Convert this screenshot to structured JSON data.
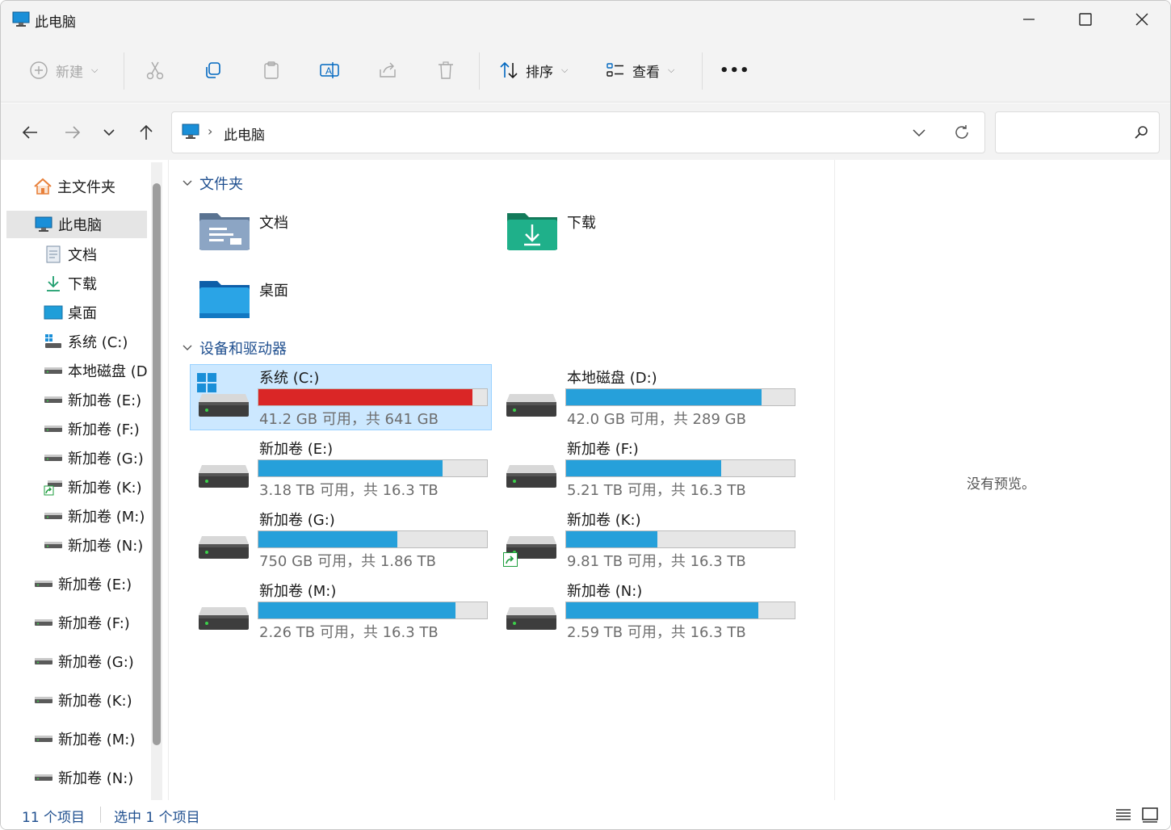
{
  "window": {
    "title": "此电脑"
  },
  "toolbar": {
    "new_label": "新建",
    "sort_label": "排序",
    "view_label": "查看",
    "more_label": "•••"
  },
  "nav": {
    "breadcrumb": "此电脑",
    "breadcrumb_separator": "›",
    "search_placeholder": ""
  },
  "sidebar": {
    "home": "主文件夹",
    "this_pc": "此电脑",
    "items": [
      {
        "label": "文档",
        "icon": "documents-icon"
      },
      {
        "label": "下载",
        "icon": "downloads-icon"
      },
      {
        "label": "桌面",
        "icon": "desktop-icon"
      },
      {
        "label": "系统 (C:)",
        "icon": "windows-drive-icon"
      },
      {
        "label": "本地磁盘 (D",
        "icon": "drive-icon"
      },
      {
        "label": "新加卷 (E:)",
        "icon": "drive-icon"
      },
      {
        "label": "新加卷 (F:)",
        "icon": "drive-icon"
      },
      {
        "label": "新加卷 (G:)",
        "icon": "drive-icon"
      },
      {
        "label": "新加卷 (K:)",
        "icon": "network-drive-icon"
      },
      {
        "label": "新加卷 (M:)",
        "icon": "drive-icon"
      },
      {
        "label": "新加卷 (N:)",
        "icon": "drive-icon"
      }
    ],
    "drives": [
      {
        "label": "新加卷 (E:)"
      },
      {
        "label": "新加卷 (F:)"
      },
      {
        "label": "新加卷 (G:)"
      },
      {
        "label": "新加卷 (K:)"
      },
      {
        "label": "新加卷 (M:)"
      },
      {
        "label": "新加卷 (N:)"
      }
    ]
  },
  "main": {
    "folders_header": "文件夹",
    "folders": [
      {
        "name": "文档",
        "icon": "documents-folder-icon"
      },
      {
        "name": "下载",
        "icon": "downloads-folder-icon"
      },
      {
        "name": "桌面",
        "icon": "desktop-folder-icon"
      }
    ],
    "drives_header": "设备和驱动器",
    "drives": [
      {
        "name": "系统 (C:)",
        "info": "41.2 GB 可用，共 641 GB",
        "used_fraction": 0.936,
        "full": true,
        "selected": true
      },
      {
        "name": "本地磁盘 (D:)",
        "info": "42.0 GB 可用，共 289 GB",
        "used_fraction": 0.855
      },
      {
        "name": "新加卷 (E:)",
        "info": "3.18 TB 可用，共 16.3 TB",
        "used_fraction": 0.805
      },
      {
        "name": "新加卷 (F:)",
        "info": "5.21 TB 可用，共 16.3 TB",
        "used_fraction": 0.68
      },
      {
        "name": "新加卷 (G:)",
        "info": "750 GB 可用，共 1.86 TB",
        "used_fraction": 0.607
      },
      {
        "name": "新加卷 (K:)",
        "info": "9.81 TB 可用，共 16.3 TB",
        "used_fraction": 0.398,
        "shared": true
      },
      {
        "name": "新加卷 (M:)",
        "info": "2.26 TB 可用，共 16.3 TB",
        "used_fraction": 0.861
      },
      {
        "name": "新加卷 (N:)",
        "info": "2.59 TB 可用，共 16.3 TB",
        "used_fraction": 0.841
      }
    ]
  },
  "preview": {
    "empty_text": "没有预览。"
  },
  "status": {
    "item_count": "11 个项目",
    "selected_count": "选中 1 个项目"
  },
  "colors": {
    "accent": "#26a0da",
    "full_drive": "#da2626",
    "selection": "#cce8ff",
    "link_text": "#1f4f8f"
  }
}
